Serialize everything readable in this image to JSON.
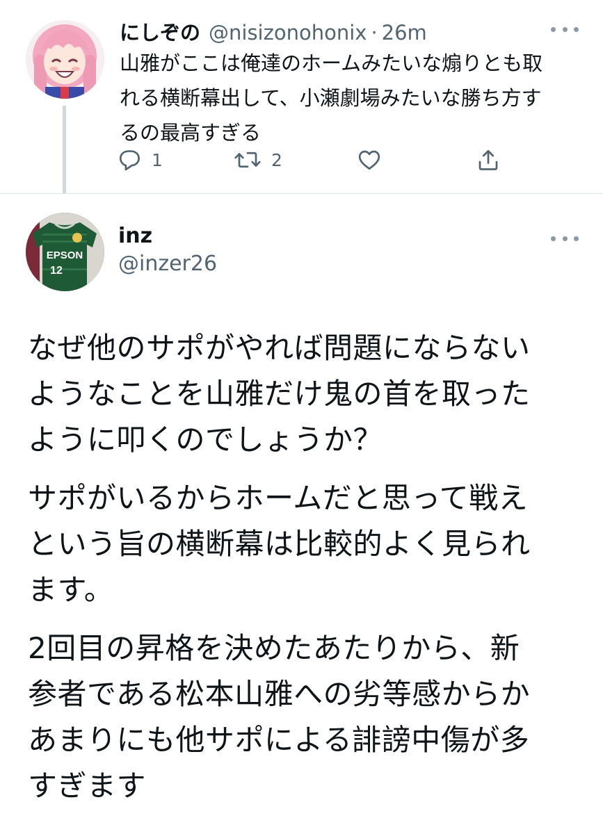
{
  "parent_tweet": {
    "display_name": "にしぞの",
    "handle": "@nisizonohonix",
    "separator": "·",
    "time": "26m",
    "text": "山雅がここは俺達のホームみたいな煽りとも取\nれる横断幕出して、小瀬劇場みたいな勝ち方す\nるの最高すぎる",
    "actions": {
      "reply_count": "1",
      "retweet_count": "2"
    },
    "avatar_icon": "anime-girl-avatar-icon"
  },
  "main_tweet": {
    "display_name": "inz",
    "handle": "@inzer26",
    "avatar_icon": "green-jersey-avatar-icon",
    "avatar_jersey_text": "EPSON",
    "avatar_jersey_number": "12",
    "paragraphs": [
      "なぜ他のサポがやれば問題にならない\nようなことを山雅だけ鬼の首を取った\nように叩くのでしょうか？",
      "サポがいるからホームだと思って戦え\nという旨の横断幕は比較的よく見られ\nます。",
      "2回目の昇格を決めたあたりから、新\n参者である松本山雅への劣等感からか\nあまりにも他サポによる誹謗中傷が多\nすぎます"
    ]
  },
  "colors": {
    "text_primary": "#0f1419",
    "text_secondary": "#536471",
    "divider": "#e1e8ed",
    "thread_line": "#cfd9de"
  }
}
